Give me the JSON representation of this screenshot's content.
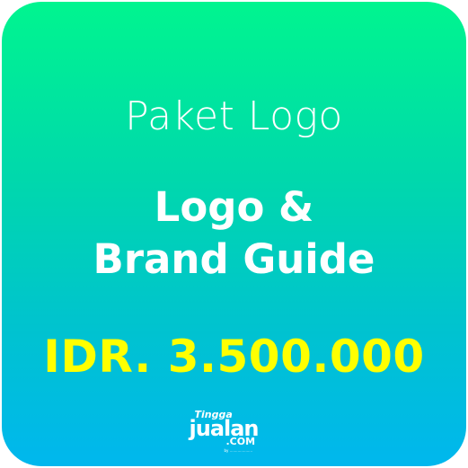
{
  "card": {
    "subtitle": "Paket Logo",
    "title_line1": "Logo &",
    "title_line2": "Brand Guide",
    "price": "IDR. 3.500.000"
  },
  "brand": {
    "small": "Tingga",
    "main": "jualan",
    "suffix": ".COM",
    "tagline": "by ...................."
  },
  "colors": {
    "gradient_top": "#00f58f",
    "gradient_bottom": "#00b7ee",
    "text": "#ffffff",
    "price": "#ffff00"
  }
}
